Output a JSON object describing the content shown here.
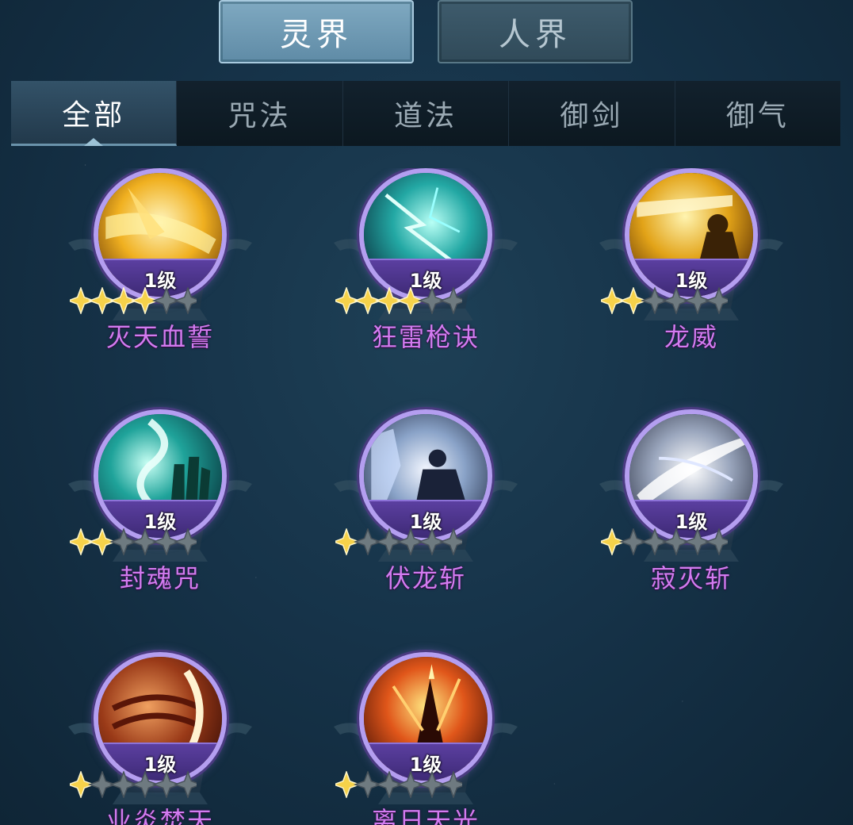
{
  "realm_tabs": [
    {
      "label": "灵界",
      "active": true
    },
    {
      "label": "人界",
      "active": false
    }
  ],
  "categories": [
    {
      "label": "全部",
      "active": true
    },
    {
      "label": "咒法",
      "active": false
    },
    {
      "label": "道法",
      "active": false
    },
    {
      "label": "御剑",
      "active": false
    },
    {
      "label": "御气",
      "active": false
    }
  ],
  "skills": [
    {
      "name": "灭天血誓",
      "level": "1级",
      "stars": 4,
      "max_stars": 6,
      "art": "gold-strike"
    },
    {
      "name": "狂雷枪诀",
      "level": "1级",
      "stars": 4,
      "max_stars": 6,
      "art": "teal-lightning"
    },
    {
      "name": "龙威",
      "level": "1级",
      "stars": 2,
      "max_stars": 6,
      "art": "gold-warrior"
    },
    {
      "name": "封魂咒",
      "level": "1级",
      "stars": 2,
      "max_stars": 6,
      "art": "teal-spirit-hand"
    },
    {
      "name": "伏龙斩",
      "level": "1级",
      "stars": 1,
      "max_stars": 6,
      "art": "ice-warrior"
    },
    {
      "name": "寂灭斩",
      "level": "1级",
      "stars": 1,
      "max_stars": 6,
      "art": "silver-slash"
    },
    {
      "name": "业炎焚天",
      "level": "1级",
      "stars": 1,
      "max_stars": 6,
      "art": "fire-sphere"
    },
    {
      "name": "离日天光",
      "level": "1级",
      "stars": 1,
      "max_stars": 6,
      "art": "fire-pillar"
    }
  ],
  "colors": {
    "skill_name": "#d27bf0",
    "star_filled": "#f6d24a",
    "star_empty": "#6e7a80",
    "ring": "#b49ef0",
    "level_band": "#4b3390"
  }
}
